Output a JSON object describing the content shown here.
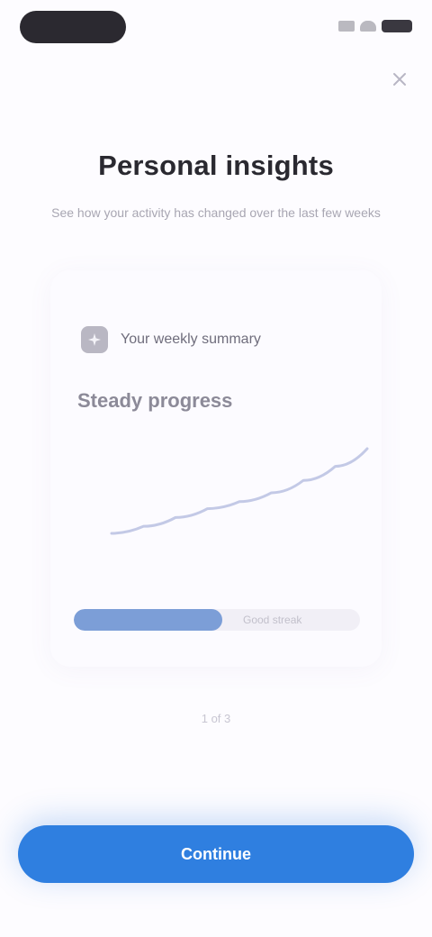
{
  "screen": {
    "title": "Personal insights",
    "subtitle": "See how your activity has changed over the last few weeks"
  },
  "card": {
    "icon": "sparkle-icon",
    "heading": "Your weekly summary",
    "value": "Steady progress",
    "caption": "",
    "trend_values": [
      18,
      22,
      27,
      32,
      36,
      41,
      48,
      56,
      66
    ],
    "progress_fraction": 0.52,
    "progress_label": "Good streak"
  },
  "footnote": "1 of 3",
  "primary_button": {
    "label": "Continue"
  },
  "colors": {
    "accent": "#2f7fe0",
    "progress": "#7c9ed7",
    "background": "#fdfcff"
  }
}
